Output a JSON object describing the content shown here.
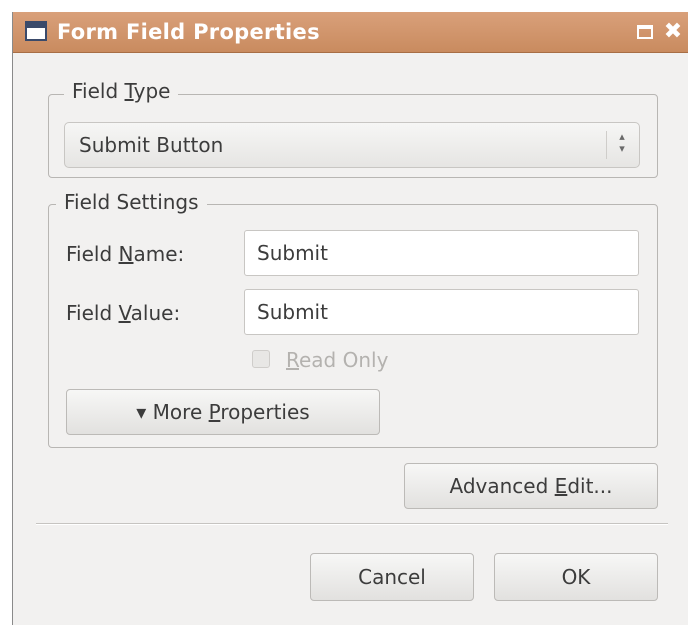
{
  "window": {
    "title": "Form Field Properties"
  },
  "field_type": {
    "legend_prefix": "Field ",
    "legend_mnemonic": "T",
    "legend_suffix": "ype",
    "selected": "Submit Button"
  },
  "field_settings": {
    "legend": "Field Settings",
    "name_label_prefix": "Field ",
    "name_label_mnemonic": "N",
    "name_label_suffix": "ame:",
    "name_value": "Submit",
    "value_label_prefix": "Field ",
    "value_label_mnemonic": "V",
    "value_label_suffix": "alue:",
    "value_value": "Submit",
    "read_only_mnemonic": "R",
    "read_only_suffix": "ead Only",
    "read_only_checked": false,
    "more_prefix": "▾ More ",
    "more_mnemonic": "P",
    "more_suffix": "roperties"
  },
  "buttons": {
    "advanced_prefix": "Advanced ",
    "advanced_mnemonic": "E",
    "advanced_suffix": "dit...",
    "cancel": "Cancel",
    "ok": "OK"
  },
  "icons": {
    "app": "form-window-icon",
    "maximize": "maximize-icon",
    "close": "close-icon",
    "spinner": "up-down-arrows-icon"
  },
  "colors": {
    "titlebar": "#c98b5f",
    "background": "#f2f1f0"
  }
}
